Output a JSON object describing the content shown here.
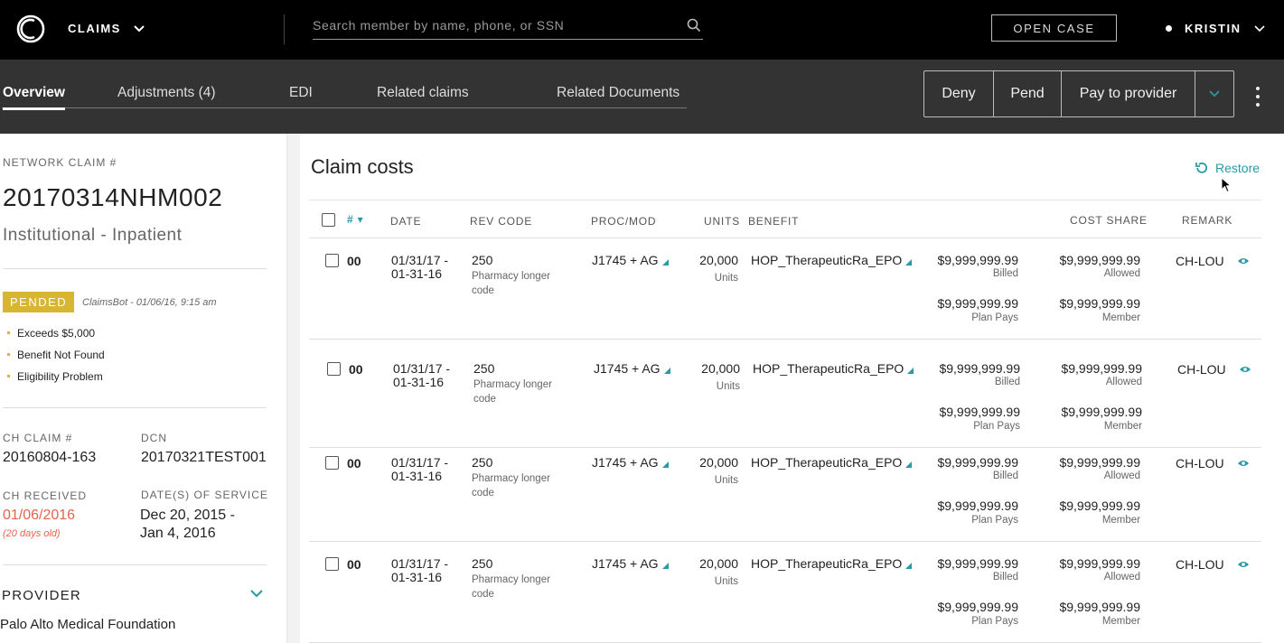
{
  "topbar": {
    "app_label": "CLAIMS",
    "search_placeholder": "Search member by name, phone, or SSN",
    "open_case_label": "OPEN CASE",
    "user_name": "KRISTIN"
  },
  "tabs": [
    {
      "label": "Overview",
      "active": true
    },
    {
      "label": "Adjustments (4)",
      "active": false
    },
    {
      "label": "EDI",
      "active": false
    },
    {
      "label": "Related claims",
      "active": false
    },
    {
      "label": "Related Documents",
      "active": false
    }
  ],
  "actions": {
    "deny": "Deny",
    "pend": "Pend",
    "pay": "Pay to provider"
  },
  "claim": {
    "network_label": "NETWORK CLAIM #",
    "number": "20170314NHM002",
    "type": "Institutional - Inpatient",
    "status": "PENDED",
    "status_by": "ClaimsBot - 01/06/16, 9:15 am",
    "reasons": [
      "Exceeds $5,000",
      "Benefit Not Found",
      "Eligibility Problem"
    ],
    "ch_claim_label": "CH CLAIM #",
    "ch_claim": "20160804-163",
    "dcn_label": "DCN",
    "dcn": "20170321TEST001",
    "ch_received_label": "CH RECEIVED",
    "ch_received": "01/06/2016",
    "ch_received_age": "(20 days old)",
    "dos_label": "DATE(S) OF SERVICE",
    "dos_line1": "Dec 20, 2015 -",
    "dos_line2": "Jan 4, 2016",
    "provider_label": "PROVIDER",
    "provider_name": "Palo Alto Medical Foundation"
  },
  "costs": {
    "title": "Claim costs",
    "restore_label": "Restore",
    "headers": {
      "num": "#",
      "date": "DATE",
      "rev_code": "REV CODE",
      "proc_mod": "PROC/MOD",
      "units": "UNITS",
      "benefit": "BENEFIT",
      "cost_share": "COST SHARE",
      "remark": "REMARK"
    },
    "rows": [
      {
        "num": "00",
        "date1": "01/31/17 -",
        "date2": "01-31-16",
        "rev": "250",
        "rev_desc1": "Pharmacy longer",
        "rev_desc2": "code",
        "proc": "J1745 + AG",
        "units": "20,000",
        "units_label": "Units",
        "benefit": "HOP_TherapeuticRa_EPO",
        "billed": "$9,999,999.99",
        "billed_label": "Billed",
        "allowed": "$9,999,999.99",
        "allowed_label": "Allowed",
        "plan_pays": "$9,999,999.99",
        "plan_pays_label": "Plan Pays",
        "member": "$9,999,999.99",
        "member_label": "Member",
        "remark": "CH-LOU"
      },
      {
        "num": "00",
        "date1": "01/31/17 -",
        "date2": "01-31-16",
        "rev": "250",
        "rev_desc1": "Pharmacy longer",
        "rev_desc2": "code",
        "proc": "J1745 + AG",
        "units": "20,000",
        "units_label": "Units",
        "benefit": "HOP_TherapeuticRa_EPO",
        "billed": "$9,999,999.99",
        "billed_label": "Billed",
        "allowed": "$9,999,999.99",
        "allowed_label": "Allowed",
        "plan_pays": "$9,999,999.99",
        "plan_pays_label": "Plan Pays",
        "member": "$9,999,999.99",
        "member_label": "Member",
        "remark": "CH-LOU"
      },
      {
        "num": "00",
        "date1": "01/31/17 -",
        "date2": "01-31-16",
        "rev": "250",
        "rev_desc1": "Pharmacy longer",
        "rev_desc2": "code",
        "proc": "J1745 + AG",
        "units": "20,000",
        "units_label": "Units",
        "benefit": "HOP_TherapeuticRa_EPO",
        "billed": "$9,999,999.99",
        "billed_label": "Billed",
        "allowed": "$9,999,999.99",
        "allowed_label": "Allowed",
        "plan_pays": "$9,999,999.99",
        "plan_pays_label": "Plan Pays",
        "member": "$9,999,999.99",
        "member_label": "Member",
        "remark": "CH-LOU"
      },
      {
        "num": "00",
        "date1": "01/31/17 -",
        "date2": "01-31-16",
        "rev": "250",
        "rev_desc1": "Pharmacy longer",
        "rev_desc2": "code",
        "proc": "J1745 + AG",
        "units": "20,000",
        "units_label": "Units",
        "benefit": "HOP_TherapeuticRa_EPO",
        "billed": "$9,999,999.99",
        "billed_label": "Billed",
        "allowed": "$9,999,999.99",
        "allowed_label": "Allowed",
        "plan_pays": "$9,999,999.99",
        "plan_pays_label": "Plan Pays",
        "member": "$9,999,999.99",
        "member_label": "Member",
        "remark": "CH-LOU"
      }
    ]
  },
  "colors": {
    "accent": "#2a9aa5",
    "pended": "#d9b632",
    "alert": "#e5624b",
    "topbar": "#000000",
    "subbar": "#333333"
  }
}
